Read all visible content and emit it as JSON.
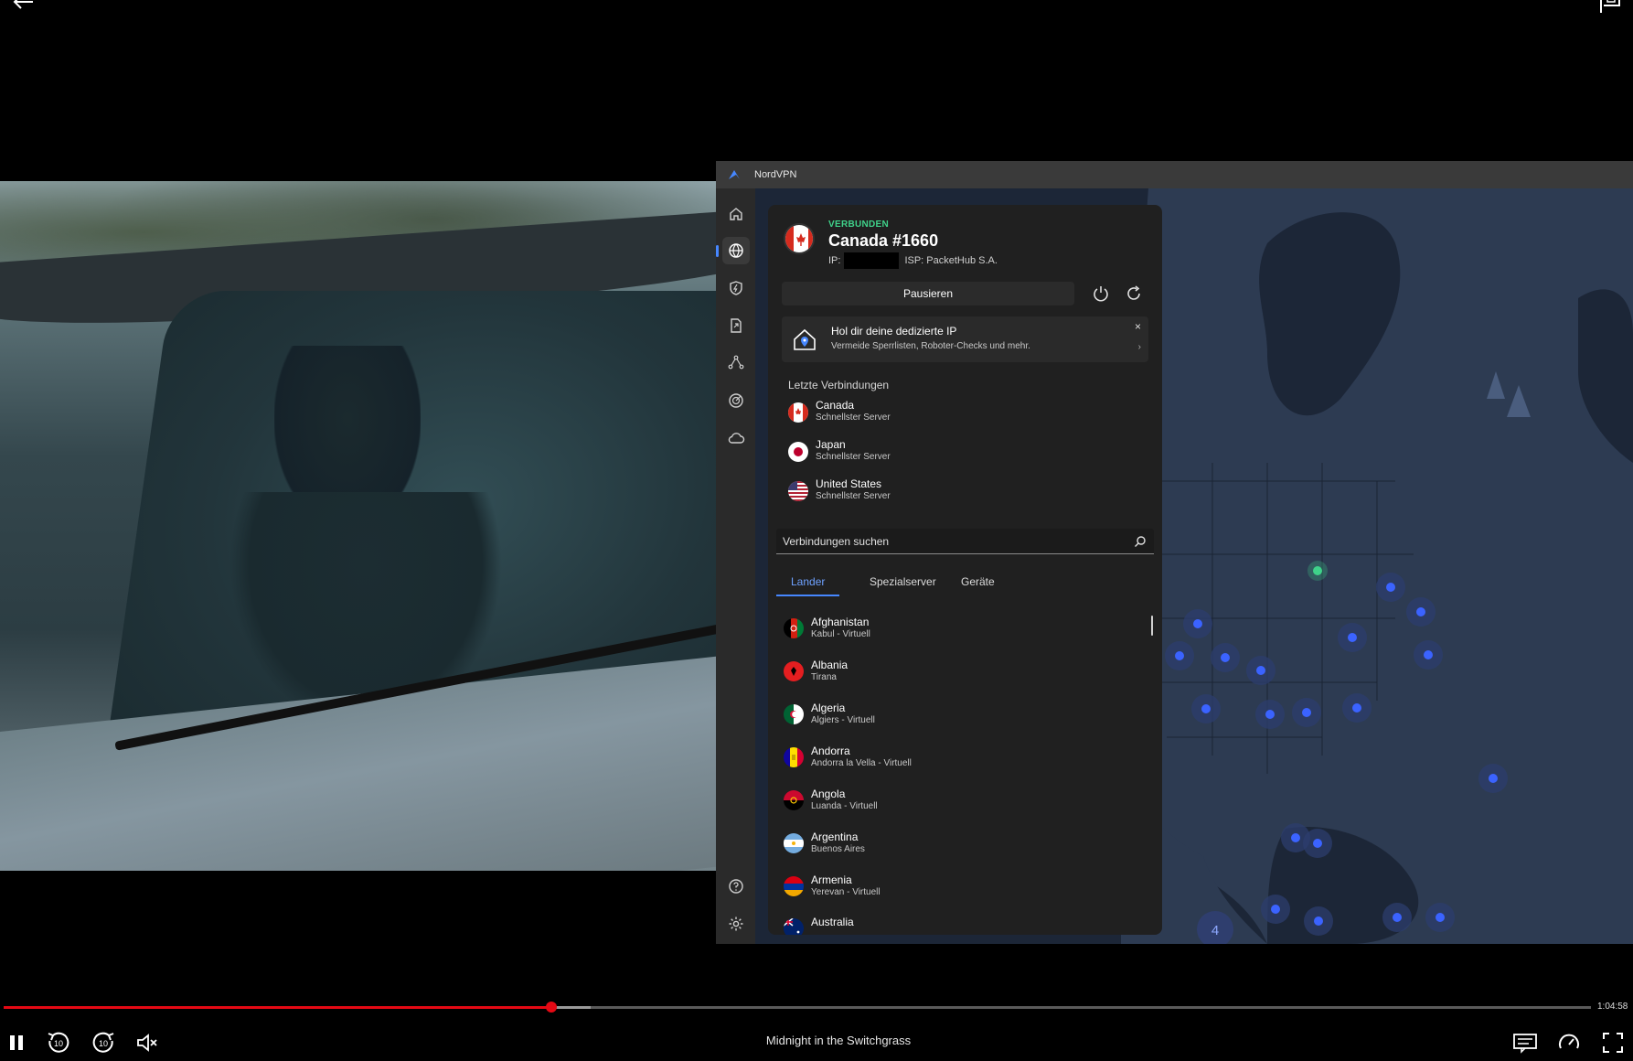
{
  "player": {
    "title": "Midnight in the Switchgrass",
    "time_remaining": "1:04:58",
    "progress_played": 0.345,
    "progress_buffered": 0.37
  },
  "nordvpn": {
    "window_title": "NordVPN",
    "status": "VERBUNDEN",
    "server": "Canada #1660",
    "ip_label": "IP:",
    "isp": "ISP: PacketHub S.A.",
    "pause_label": "Pausieren",
    "promo": {
      "title": "Hol dir deine dedizierte IP",
      "subtitle": "Vermeide Sperrlisten, Roboter-Checks und mehr.",
      "close": "×",
      "arrow": "›"
    },
    "recent_label": "Letzte Verbindungen",
    "recent": [
      {
        "name": "Canada",
        "sub": "Schnellster Server"
      },
      {
        "name": "Japan",
        "sub": "Schnellster Server"
      },
      {
        "name": "United States",
        "sub": "Schnellster Server"
      }
    ],
    "search_placeholder": "Verbindungen suchen",
    "tabs": [
      "Lander",
      "Spezialserver",
      "Geräte"
    ],
    "countries": [
      {
        "name": "Afghanistan",
        "sub": "Kabul - Virtuell"
      },
      {
        "name": "Albania",
        "sub": "Tirana"
      },
      {
        "name": "Algeria",
        "sub": "Algiers - Virtuell"
      },
      {
        "name": "Andorra",
        "sub": "Andorra la Vella - Virtuell"
      },
      {
        "name": "Angola",
        "sub": "Luanda - Virtuell"
      },
      {
        "name": "Argentina",
        "sub": "Buenos Aires"
      },
      {
        "name": "Armenia",
        "sub": "Yerevan - Virtuell"
      },
      {
        "name": "Australia",
        "sub": ""
      }
    ],
    "map_cluster_label": "4",
    "colors": {
      "accent": "#4687ff",
      "connected": "#3fd28a",
      "map_bg": "#1c2637",
      "server_dot": "#3b63ff"
    }
  }
}
